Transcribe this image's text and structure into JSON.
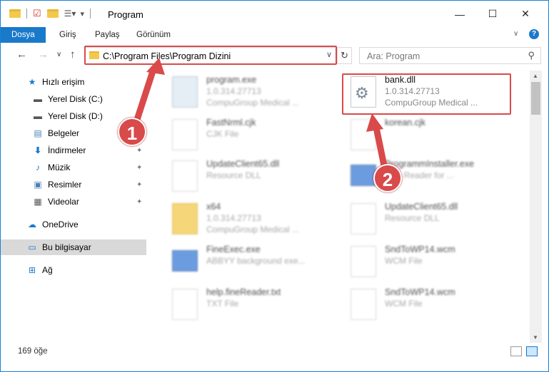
{
  "window": {
    "title": "Program",
    "minimize": "—",
    "maximize": "☐",
    "close": "✕"
  },
  "ribbon": {
    "tabs": [
      "Dosya",
      "Giriş",
      "Paylaş",
      "Görünüm"
    ]
  },
  "address": {
    "path": "C:\\Program Files\\Program Dizini",
    "refresh": "↻",
    "dropdown": "∨"
  },
  "search": {
    "placeholder": "Ara: Program",
    "icon": "search-icon"
  },
  "sidebar": {
    "items": [
      {
        "label": "Hızlı erişim",
        "icon": "star-icon"
      },
      {
        "label": "Yerel Disk (C:)",
        "icon": "drive-icon"
      },
      {
        "label": "Yerel Disk (D:)",
        "icon": "drive-icon"
      },
      {
        "label": "Belgeler",
        "icon": "documents-icon"
      },
      {
        "label": "İndirmeler",
        "icon": "download-icon"
      },
      {
        "label": "Müzik",
        "icon": "music-icon"
      },
      {
        "label": "Resimler",
        "icon": "pictures-icon"
      },
      {
        "label": "Videolar",
        "icon": "videos-icon"
      },
      {
        "label": "OneDrive",
        "icon": "cloud-icon"
      },
      {
        "label": "Bu bilgisayar",
        "icon": "computer-icon"
      },
      {
        "label": "Ağ",
        "icon": "network-icon"
      }
    ]
  },
  "files": [
    {
      "name": "program.exe",
      "line1": "1.0.314.27713",
      "line2": "CompuGroup Medical ...",
      "blurred": true
    },
    {
      "name": "bank.dll",
      "line1": "1.0.314.27713",
      "line2": "CompuGroup Medical ...",
      "blurred": false
    },
    {
      "name": "FastNrml.cjk",
      "line1": "CJK File",
      "line2": "",
      "blurred": true
    },
    {
      "name": "korean.cjk",
      "line1": "",
      "line2": "",
      "blurred": true
    },
    {
      "name": "UpdateClient65.dll",
      "line1": "Resource DLL",
      "line2": "",
      "blurred": true
    },
    {
      "name": "ProgrammInstaller.exe",
      "line1": "Fine Reader for ...",
      "line2": "",
      "blurred": true
    },
    {
      "name": "x64",
      "line1": "1.0.314.27713",
      "line2": "CompuGroup Medical ...",
      "blurred": true
    },
    {
      "name": "UpdateClient65.dll",
      "line1": "Resource DLL",
      "line2": "",
      "blurred": true
    },
    {
      "name": "FineExec.exe",
      "line1": "ABBYY background exe...",
      "line2": "",
      "blurred": true
    },
    {
      "name": "SndToWP14.wcm",
      "line1": "WCM File",
      "line2": "",
      "blurred": true
    },
    {
      "name": "help.fineReader.txt",
      "line1": "TXT File",
      "line2": "",
      "blurred": true
    },
    {
      "name": "SndToWP14.wcm",
      "line1": "WCM File",
      "line2": "",
      "blurred": true
    }
  ],
  "status": {
    "count": "169 öğe"
  },
  "callouts": [
    "1",
    "2"
  ],
  "colors": {
    "accent": "#1979ca",
    "highlight_red": "#d94a4a"
  }
}
